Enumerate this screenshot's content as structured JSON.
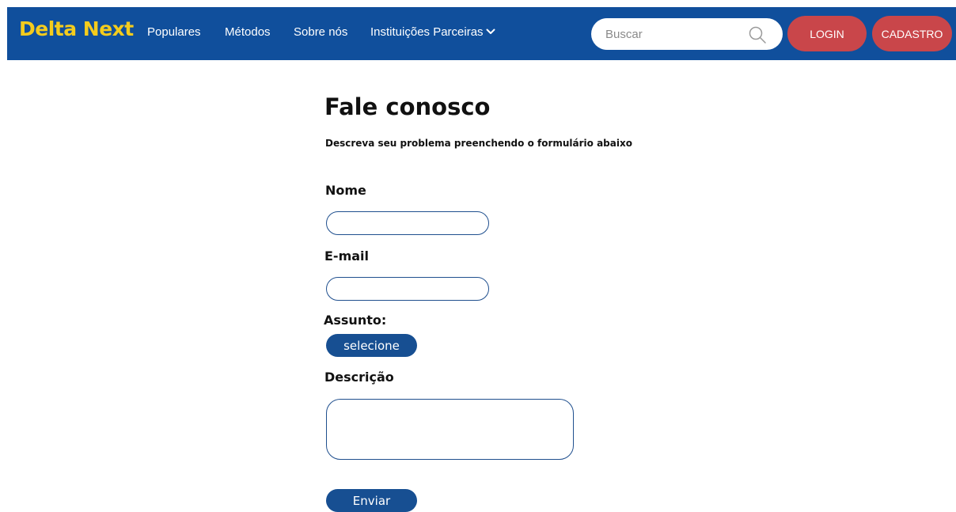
{
  "navbar": {
    "brand": "Delta Next",
    "links": [
      {
        "label": "Populares"
      },
      {
        "label": "Métodos"
      },
      {
        "label": "Sobre nós"
      },
      {
        "label": "Instituições Parceiras"
      }
    ],
    "search_placeholder": "Buscar",
    "login_label": "LOGIN",
    "signup_label": "CADASTRO"
  },
  "form": {
    "title": "Fale conosco",
    "subtitle": "Descreva seu problema preenchendo o formulário abaixo",
    "name_label": "Nome",
    "name_value": "",
    "email_label": "E-mail",
    "email_value": "",
    "subject_label": "Assunto:",
    "subject_select": "selecione",
    "description_label": "Descrição",
    "description_value": "",
    "submit_label": "Enviar"
  },
  "colors": {
    "navbar_bg": "#104f9c",
    "brand": "#f4cc1d",
    "pill_red": "#c9464a",
    "button_blue": "#174f92"
  },
  "icons": {
    "search": "search-icon",
    "dropdown": "chevron-down-icon"
  }
}
